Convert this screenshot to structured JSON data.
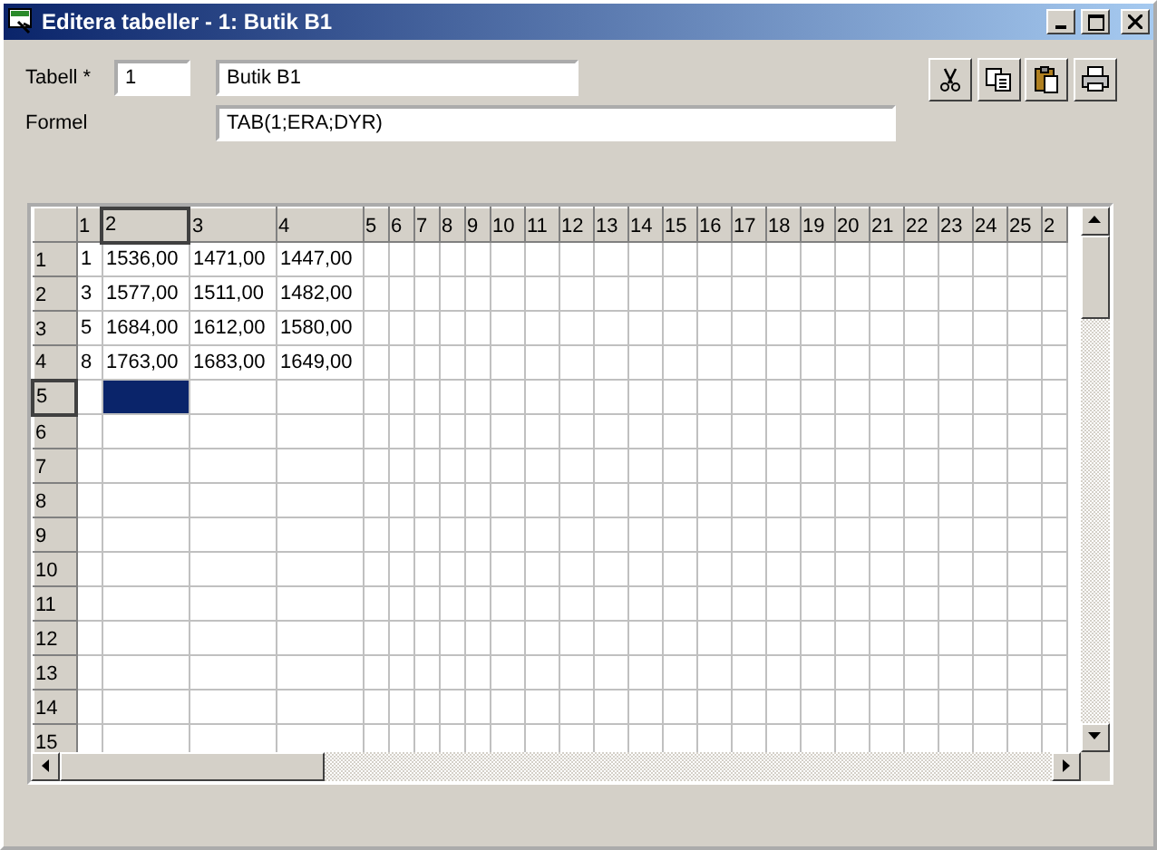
{
  "window": {
    "title": "Editera tabeller - 1: Butik B1"
  },
  "form": {
    "table_label": "Tabell *",
    "table_number": "1",
    "table_name": "Butik B1",
    "formula_label": "Formel",
    "formula": "TAB(1;ERA;DYR)"
  },
  "toolbar": [
    {
      "kind": "cut"
    },
    {
      "kind": "copy"
    },
    {
      "kind": "paste"
    },
    {
      "kind": "print"
    }
  ],
  "grid": {
    "columns": [
      {
        "label": "1",
        "selected": false
      },
      {
        "label": "2",
        "selected": true
      },
      {
        "label": "3",
        "selected": false
      },
      {
        "label": "4",
        "selected": false
      },
      {
        "label": "5",
        "selected": false
      },
      {
        "label": "6",
        "selected": false
      },
      {
        "label": "7",
        "selected": false
      },
      {
        "label": "8",
        "selected": false
      },
      {
        "label": "9",
        "selected": false
      },
      {
        "label": "10",
        "selected": false
      },
      {
        "label": "11",
        "selected": false
      },
      {
        "label": "12",
        "selected": false
      },
      {
        "label": "13",
        "selected": false
      },
      {
        "label": "14",
        "selected": false
      },
      {
        "label": "15",
        "selected": false
      },
      {
        "label": "16",
        "selected": false
      },
      {
        "label": "17",
        "selected": false
      },
      {
        "label": "18",
        "selected": false
      },
      {
        "label": "19",
        "selected": false
      },
      {
        "label": "20",
        "selected": false
      },
      {
        "label": "21",
        "selected": false
      },
      {
        "label": "22",
        "selected": false
      },
      {
        "label": "23",
        "selected": false
      },
      {
        "label": "24",
        "selected": false
      },
      {
        "label": "25",
        "selected": false
      },
      {
        "label": "2",
        "selected": false
      }
    ],
    "rows": [
      {
        "header": "1",
        "selected": false,
        "cells": [
          "1",
          "1536,00",
          "1471,00",
          "1447,00"
        ]
      },
      {
        "header": "2",
        "selected": false,
        "cells": [
          "3",
          "1577,00",
          "1511,00",
          "1482,00"
        ]
      },
      {
        "header": "3",
        "selected": false,
        "cells": [
          "5",
          "1684,00",
          "1612,00",
          "1580,00"
        ]
      },
      {
        "header": "4",
        "selected": false,
        "cells": [
          "8",
          "1763,00",
          "1683,00",
          "1649,00"
        ]
      },
      {
        "header": "5",
        "selected": true
      },
      {
        "header": "6",
        "selected": false
      },
      {
        "header": "7",
        "selected": false
      },
      {
        "header": "8",
        "selected": false
      },
      {
        "header": "9",
        "selected": false
      },
      {
        "header": "10",
        "selected": false
      },
      {
        "header": "11",
        "selected": false
      },
      {
        "header": "12",
        "selected": false
      },
      {
        "header": "13",
        "selected": false
      },
      {
        "header": "14",
        "selected": false
      },
      {
        "header": "15",
        "selected": false
      }
    ]
  }
}
